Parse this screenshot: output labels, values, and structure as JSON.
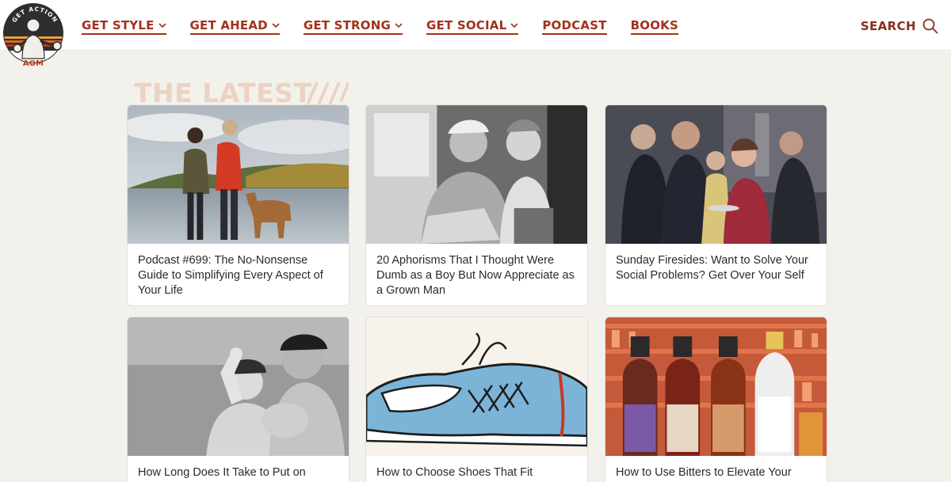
{
  "logo": {
    "top_text": "GET ACTION",
    "bottom_text": "AOM"
  },
  "nav": {
    "items": [
      {
        "label": "GET STYLE",
        "has_dropdown": true
      },
      {
        "label": "GET AHEAD",
        "has_dropdown": true
      },
      {
        "label": "GET STRONG",
        "has_dropdown": true
      },
      {
        "label": "GET SOCIAL",
        "has_dropdown": true
      },
      {
        "label": "PODCAST",
        "has_dropdown": false
      },
      {
        "label": "BOOKS",
        "has_dropdown": false
      }
    ],
    "search_label": "SEARCH"
  },
  "section": {
    "heading": "THE LATEST"
  },
  "articles": [
    {
      "title": "Podcast #699: The No-Nonsense Guide to Simplifying Every Aspect of Your Life",
      "image": "couple-with-dog-at-lake-photo"
    },
    {
      "title": "20 Aphorisms That I Thought Were Dumb as a Boy But Now Appreciate as a Grown Man",
      "image": "grandfather-and-boy-reading-photo"
    },
    {
      "title": "Sunday Firesides: Want to Solve Your Social Problems? Get Over Your Self",
      "image": "vintage-cocktail-party-photo"
    },
    {
      "title": "How Long Does It Take to Put on",
      "image": "vintage-strongman-and-woman-photo"
    },
    {
      "title": "How to Choose Shoes That Fit",
      "image": "blue-sneaker-illustration"
    },
    {
      "title": "How to Use Bitters to Elevate Your",
      "image": "bitters-bottles-photo"
    }
  ],
  "colors": {
    "brand_red": "#a3311c",
    "background": "#f3f1ec",
    "heading_faded": "#ecd2c2"
  }
}
